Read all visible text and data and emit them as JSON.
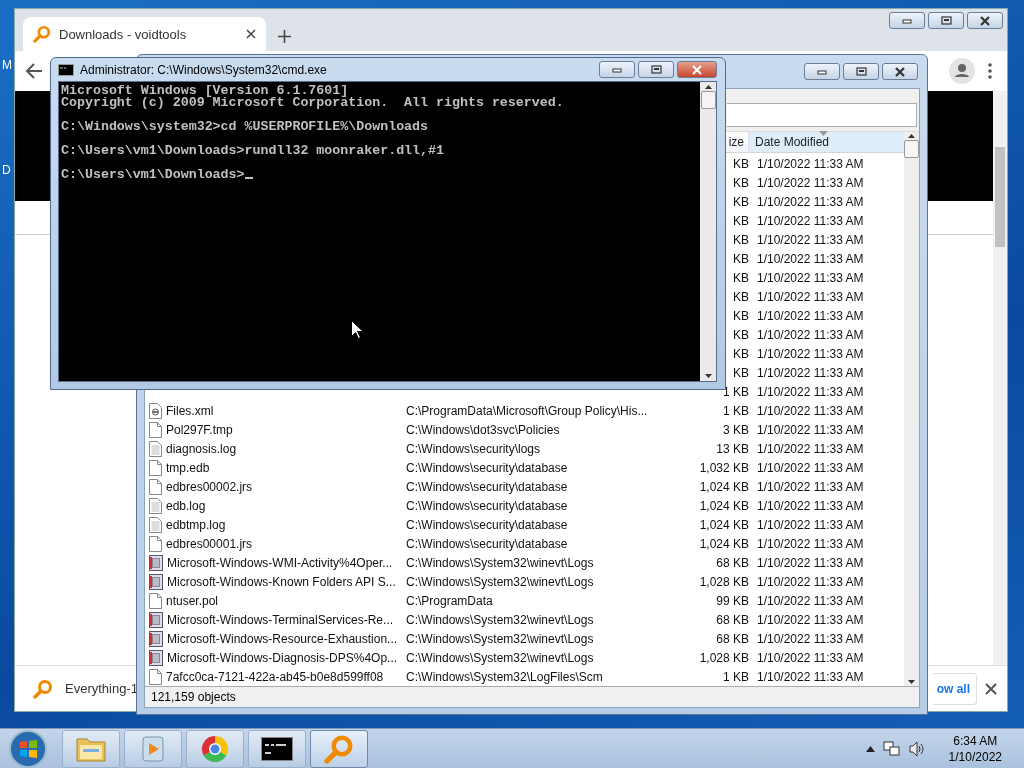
{
  "desktop": {
    "icon_labels": [
      "M",
      "D"
    ]
  },
  "browser": {
    "tabs": [
      {
        "title": "Downloads - voidtools",
        "selected": true
      }
    ],
    "download_bar": {
      "item": "Everything-1",
      "show_all": "ow all"
    }
  },
  "everything": {
    "columns": [
      "ize",
      "Date Modified"
    ],
    "rows": [
      {
        "size": "KB",
        "date": "1/10/2022 11:33 AM"
      },
      {
        "size": "KB",
        "date": "1/10/2022 11:33 AM"
      },
      {
        "size": "KB",
        "date": "1/10/2022 11:33 AM"
      },
      {
        "size": "KB",
        "date": "1/10/2022 11:33 AM"
      },
      {
        "size": "KB",
        "date": "1/10/2022 11:33 AM"
      },
      {
        "size": "KB",
        "date": "1/10/2022 11:33 AM"
      },
      {
        "size": "KB",
        "date": "1/10/2022 11:33 AM"
      },
      {
        "size": "KB",
        "date": "1/10/2022 11:33 AM"
      },
      {
        "size": "KB",
        "date": "1/10/2022 11:33 AM"
      },
      {
        "size": "KB",
        "date": "1/10/2022 11:33 AM"
      },
      {
        "size": "KB",
        "date": "1/10/2022 11:33 AM"
      },
      {
        "size": "KB",
        "date": "1/10/2022 11:33 AM"
      },
      {
        "size": "1 KB",
        "date": "1/10/2022 11:33 AM"
      },
      {
        "kind": "xml",
        "name": "Files.xml",
        "path": "C:\\ProgramData\\Microsoft\\Group Policy\\His...",
        "size": "1 KB",
        "date": "1/10/2022 11:33 AM"
      },
      {
        "kind": "file",
        "name": "Pol297F.tmp",
        "path": "C:\\Windows\\dot3svc\\Policies",
        "size": "3 KB",
        "date": "1/10/2022 11:33 AM"
      },
      {
        "kind": "text",
        "name": "diagnosis.log",
        "path": "C:\\Windows\\security\\logs",
        "size": "13 KB",
        "date": "1/10/2022 11:33 AM"
      },
      {
        "kind": "file",
        "name": "tmp.edb",
        "path": "C:\\Windows\\security\\database",
        "size": "1,032 KB",
        "date": "1/10/2022 11:33 AM"
      },
      {
        "kind": "file",
        "name": "edbres00002.jrs",
        "path": "C:\\Windows\\security\\database",
        "size": "1,024 KB",
        "date": "1/10/2022 11:33 AM"
      },
      {
        "kind": "text",
        "name": "edb.log",
        "path": "C:\\Windows\\security\\database",
        "size": "1,024 KB",
        "date": "1/10/2022 11:33 AM"
      },
      {
        "kind": "text",
        "name": "edbtmp.log",
        "path": "C:\\Windows\\security\\database",
        "size": "1,024 KB",
        "date": "1/10/2022 11:33 AM"
      },
      {
        "kind": "file",
        "name": "edbres00001.jrs",
        "path": "C:\\Windows\\security\\database",
        "size": "1,024 KB",
        "date": "1/10/2022 11:33 AM"
      },
      {
        "kind": "event",
        "name": "Microsoft-Windows-WMI-Activity%4Oper...",
        "path": "C:\\Windows\\System32\\winevt\\Logs",
        "size": "68 KB",
        "date": "1/10/2022 11:33 AM"
      },
      {
        "kind": "event",
        "name": "Microsoft-Windows-Known Folders API S...",
        "path": "C:\\Windows\\System32\\winevt\\Logs",
        "size": "1,028 KB",
        "date": "1/10/2022 11:33 AM"
      },
      {
        "kind": "file",
        "name": "ntuser.pol",
        "path": "C:\\ProgramData",
        "size": "99 KB",
        "date": "1/10/2022 11:33 AM"
      },
      {
        "kind": "event",
        "name": "Microsoft-Windows-TerminalServices-Re...",
        "path": "C:\\Windows\\System32\\winevt\\Logs",
        "size": "68 KB",
        "date": "1/10/2022 11:33 AM"
      },
      {
        "kind": "event",
        "name": "Microsoft-Windows-Resource-Exhaustion...",
        "path": "C:\\Windows\\System32\\winevt\\Logs",
        "size": "68 KB",
        "date": "1/10/2022 11:33 AM"
      },
      {
        "kind": "event",
        "name": "Microsoft-Windows-Diagnosis-DPS%4Op...",
        "path": "C:\\Windows\\System32\\winevt\\Logs",
        "size": "1,028 KB",
        "date": "1/10/2022 11:33 AM"
      },
      {
        "kind": "file",
        "name": "7afcc0ca-7121-422a-ab45-b0e8d599ff08",
        "path": "C:\\Windows\\System32\\LogFiles\\Scm",
        "size": "1 KB",
        "date": "1/10/2022 11:33 AM"
      }
    ],
    "status": "121,159 objects"
  },
  "cmd": {
    "title": "Administrator: C:\\Windows\\System32\\cmd.exe",
    "blocks": [
      [
        "Microsoft Windows [Version 6.1.7601]",
        "Copyright (c) 2009 Microsoft Corporation.  All rights reserved."
      ],
      [
        "C:\\Windows\\system32>cd %USERPROFILE%\\Downloads"
      ],
      [
        "C:\\Users\\vm1\\Downloads>rundll32 moonraker.dll,#1"
      ],
      [
        "C:\\Users\\vm1\\Downloads>"
      ]
    ]
  },
  "taskbar": {
    "apps": [
      {
        "kind": "folder",
        "selected": false
      },
      {
        "kind": "media",
        "selected": false
      },
      {
        "kind": "browser",
        "selected": false
      },
      {
        "kind": "terminal",
        "selected": false
      },
      {
        "kind": "magnifier",
        "selected": true
      }
    ],
    "clock": {
      "time": "6:34 AM",
      "date": "1/10/2022"
    }
  }
}
